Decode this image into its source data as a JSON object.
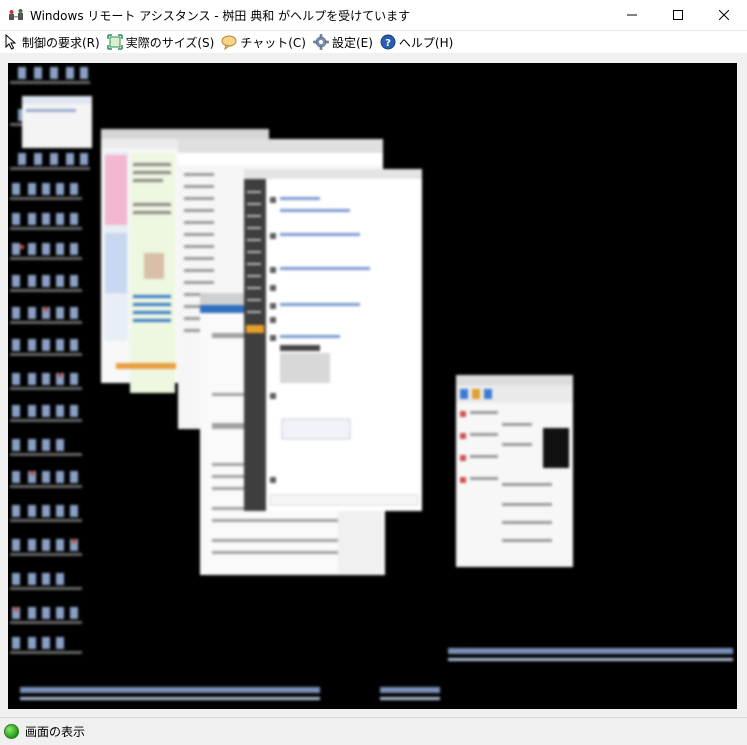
{
  "window": {
    "title": "Windows リモート アシスタンス - 桝田 典和 がヘルプを受けています",
    "controls": {
      "minimize": "minimize-icon",
      "maximize": "maximize-icon",
      "close": "close-icon"
    }
  },
  "menu": {
    "items": [
      {
        "label": "制御の要求(R)",
        "icon": "control-request-icon"
      },
      {
        "label": "実際のサイズ(S)",
        "icon": "actual-size-icon"
      },
      {
        "label": "チャット(C)",
        "icon": "chat-icon"
      },
      {
        "label": "設定(E)",
        "icon": "settings-gear-icon"
      },
      {
        "label": "ヘルプ(H)",
        "icon": "help-icon"
      }
    ]
  },
  "remote_desktop": {
    "background_color": "#000000",
    "description": "remote-desktop-view"
  },
  "status": {
    "label": "画面の表示",
    "color": "#1f9a13"
  }
}
